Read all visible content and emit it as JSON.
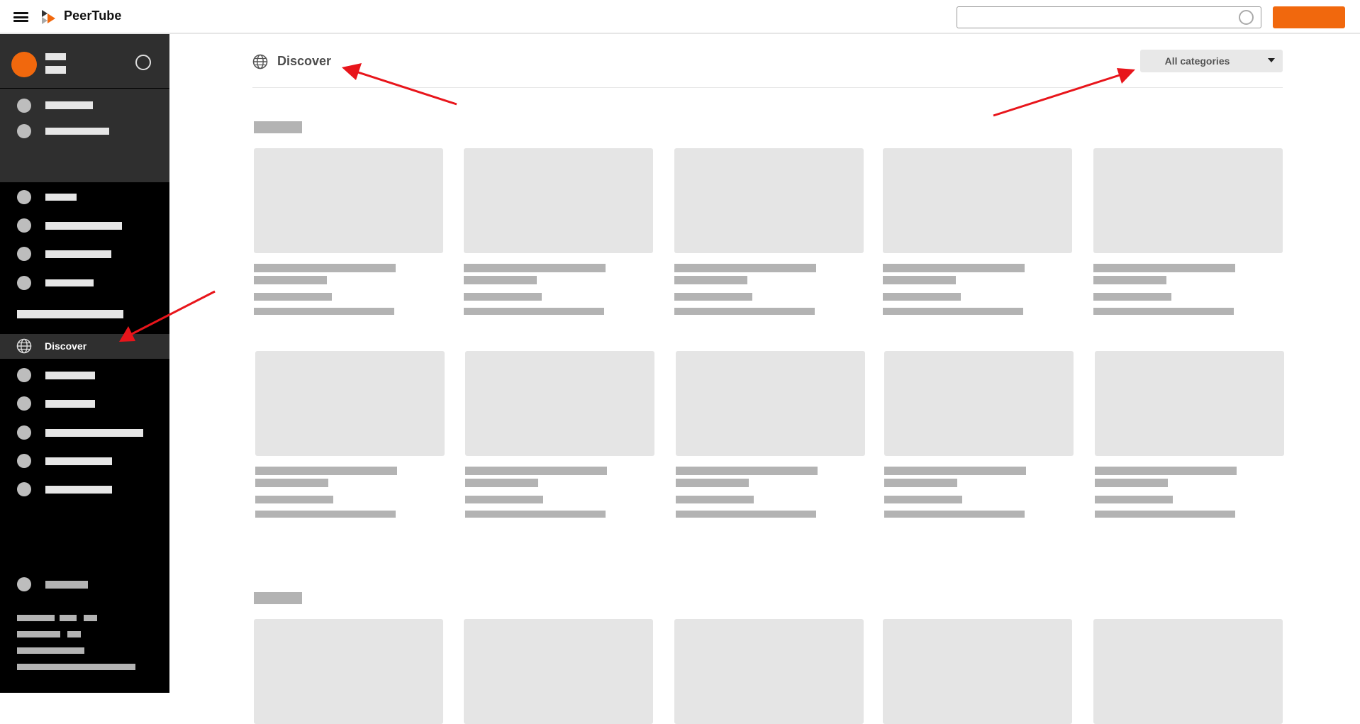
{
  "topbar": {
    "brand": "PeerTube",
    "search_placeholder": "",
    "colors": {
      "accent": "#f1680d"
    }
  },
  "sidebar": {
    "discover_label": "Discover"
  },
  "main": {
    "title": "Discover",
    "category_select": "All categories"
  },
  "annotations": {
    "arrow_color": "#e8151b"
  }
}
